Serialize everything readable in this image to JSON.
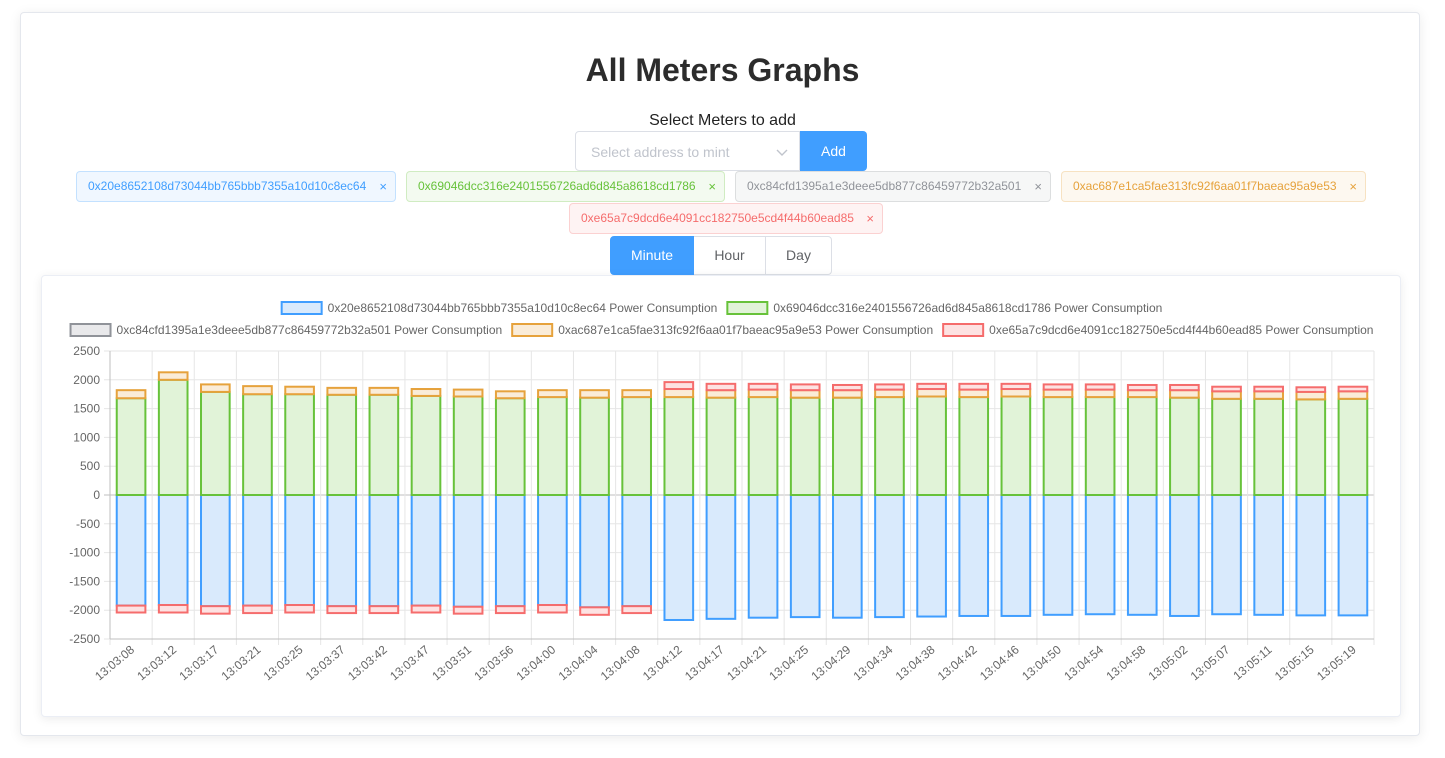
{
  "page": {
    "title": "All Meters Graphs",
    "select_label": "Select Meters to add",
    "select_placeholder": "Select address to mint",
    "add_label": "Add"
  },
  "tags": [
    {
      "label": "0x20e8652108d73044bb765bbb7355a10d10c8ec64",
      "color": "#409eff"
    },
    {
      "label": "0x69046dcc316e2401556726ad6d845a8618cd1786",
      "color": "#67c23a"
    },
    {
      "label": "0xc84cfd1395a1e3deee5db877c86459772b32a501",
      "color": "#909399"
    },
    {
      "label": "0xac687e1ca5fae313fc92f6aa01f7baeac95a9e53",
      "color": "#e6a23c"
    },
    {
      "label": "0xe65a7c9dcd6e4091cc182750e5cd4f44b60ead85",
      "color": "#f56c6c"
    }
  ],
  "tag_close_glyph": "×",
  "range_buttons": [
    {
      "label": "Minute",
      "active": true
    },
    {
      "label": "Hour",
      "active": false
    },
    {
      "label": "Day",
      "active": false
    }
  ],
  "chart_data": {
    "type": "bar",
    "stacked": true,
    "legend_position": "top",
    "grid": true,
    "ylim": [
      -2500,
      2500
    ],
    "yticks": [
      2500,
      2000,
      1500,
      1000,
      500,
      0,
      -500,
      -1000,
      -1500,
      -2000,
      -2500
    ],
    "categories": [
      "13:03:08",
      "13:03:12",
      "13:03:17",
      "13:03:21",
      "13:03:25",
      "13:03:37",
      "13:03:42",
      "13:03:47",
      "13:03:51",
      "13:03:56",
      "13:04:00",
      "13:04:04",
      "13:04:08",
      "13:04:12",
      "13:04:17",
      "13:04:21",
      "13:04:25",
      "13:04:29",
      "13:04:34",
      "13:04:38",
      "13:04:42",
      "13:04:46",
      "13:04:50",
      "13:04:54",
      "13:04:58",
      "13:05:02",
      "13:05:07",
      "13:05:11",
      "13:05:15",
      "13:05:19"
    ],
    "series": [
      {
        "name": "0x20e8652108d73044bb765bbb7355a10d10c8ec64 Power Consumption",
        "border": "#409eff",
        "fill": "#d9eafc",
        "values": [
          -1920,
          -1910,
          -1930,
          -1920,
          -1910,
          -1930,
          -1930,
          -1920,
          -1940,
          -1930,
          -1910,
          -1950,
          -1930,
          -2170,
          -2150,
          -2130,
          -2120,
          -2130,
          -2120,
          -2110,
          -2100,
          -2100,
          -2080,
          -2070,
          -2080,
          -2100,
          -2070,
          -2080,
          -2090,
          -2090
        ]
      },
      {
        "name": "0x69046dcc316e2401556726ad6d845a8618cd1786 Power Consumption",
        "border": "#67c23a",
        "fill": "#e1f3d8",
        "values": [
          1680,
          2000,
          1790,
          1750,
          1750,
          1740,
          1740,
          1720,
          1710,
          1680,
          1700,
          1690,
          1700,
          1700,
          1690,
          1700,
          1690,
          1690,
          1700,
          1710,
          1700,
          1710,
          1700,
          1700,
          1700,
          1690,
          1670,
          1670,
          1660,
          1670
        ]
      },
      {
        "name": "0xc84cfd1395a1e3deee5db877c86459772b32a501 Power Consumption",
        "border": "#909399",
        "fill": "#e9e9eb",
        "values": [
          0,
          0,
          0,
          0,
          0,
          0,
          0,
          0,
          0,
          0,
          0,
          0,
          0,
          0,
          0,
          0,
          0,
          0,
          0,
          0,
          0,
          0,
          0,
          0,
          0,
          0,
          0,
          0,
          0,
          0
        ]
      },
      {
        "name": "0xac687e1ca5fae313fc92f6aa01f7baeac95a9e53 Power Consumption",
        "border": "#e6a23c",
        "fill": "#faecd8",
        "values": [
          140,
          130,
          130,
          140,
          130,
          120,
          120,
          120,
          120,
          120,
          120,
          130,
          120,
          140,
          130,
          130,
          130,
          130,
          130,
          130,
          130,
          130,
          130,
          130,
          120,
          130,
          130,
          130,
          130,
          130
        ]
      },
      {
        "name": "0xe65a7c9dcd6e4091cc182750e5cd4f44b60ead85 Power Consumption",
        "border": "#f56c6c",
        "fill": "#fde2e2",
        "values": [
          -120,
          -130,
          -130,
          -130,
          -130,
          -120,
          -120,
          -120,
          -120,
          -120,
          -130,
          -130,
          -120,
          120,
          110,
          100,
          100,
          90,
          90,
          90,
          100,
          90,
          90,
          90,
          90,
          90,
          80,
          80,
          80,
          80
        ]
      }
    ]
  }
}
